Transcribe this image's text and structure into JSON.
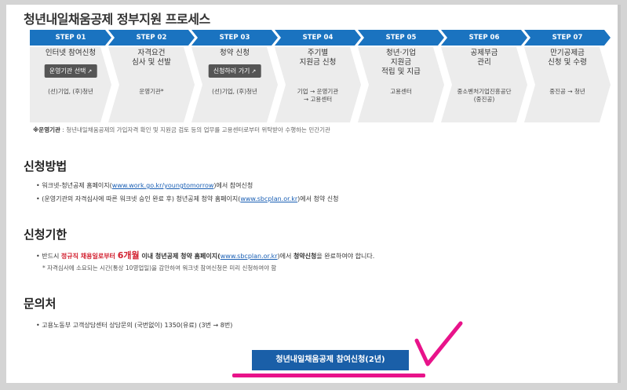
{
  "title": "청년내일채움공제 정부지원 프로세스",
  "steps": [
    {
      "header": "STEP 01",
      "name": "인터넷 참여신청",
      "button": "운영기관 선택",
      "who": "(선)기업, (후)청년"
    },
    {
      "header": "STEP 02",
      "name": "자격요건\n심사 및 선발",
      "who": "운영기관*"
    },
    {
      "header": "STEP 03",
      "name": "청약 신청",
      "button": "신청하러 가기",
      "who": "(선)기업, (후)청년"
    },
    {
      "header": "STEP 04",
      "name": "주기별\n지원금 신청",
      "who": "기업 → 운영기관\n→ 고용센터"
    },
    {
      "header": "STEP 05",
      "name": "청년·기업\n지원금\n적립 및 지급",
      "who": "고용센터"
    },
    {
      "header": "STEP 06",
      "name": "공제부금\n관리",
      "who": "중소벤처기업진흥공단\n(중진공)"
    },
    {
      "header": "STEP 07",
      "name": "만기공제금\n신청 및 수령",
      "who": "중진공 → 청년"
    }
  ],
  "note": {
    "label": "※운영기관",
    "text": " : 청년내일채움공제의 가입자격 확인 및 지원금 검토 등의 업무를 고용센터로부터 위탁받아 수행하는 민간기관"
  },
  "apply_method": {
    "title": "신청방법",
    "b1_pre": "워크넷-청년공제 홈페이지(",
    "b1_link": "www.work.go.kr/youngtomorrow",
    "b1_post": ")에서 참여신청",
    "b2_pre": "(운영기관의 자격심사에 따른 워크넷 승인 완료 후) 청년공제 청약 홈페이지(",
    "b2_link": "www.sbcplan.or.kr",
    "b2_post": ")에서 청약 신청"
  },
  "deadline": {
    "title": "신청기한",
    "pre": "반드시 ",
    "red1": "정규직 채용일로부터 ",
    "red2": "6개월",
    "mid": " 이내 청년공제 청약 홈페이지(",
    "link": "www.sbcplan.or.kr",
    "post1": ")에서 ",
    "bold": "청약신청",
    "post2": "을 완료하여야 합니다.",
    "sub": "* 자격심사에 소요되는 시간(통상 10영업일)을 감안하여 워크넷 참여신청은 미리 신청하여야 함"
  },
  "contact": {
    "title": "문의처",
    "text": "고용노동부 고객상담센터 상담문의 (국번없이) 1350(유료) (3번 → 8번)"
  },
  "cta_label": "청년내일채움공제 참여신청(2년)",
  "colors": {
    "step_header": "#1a73c0",
    "step_body": "#ececec",
    "cta": "#1a5fa8",
    "highlight": "#e8138a",
    "emphasis": "#d2202f"
  },
  "icons": {
    "external": "external-link-icon",
    "check": "check-mark-icon"
  }
}
